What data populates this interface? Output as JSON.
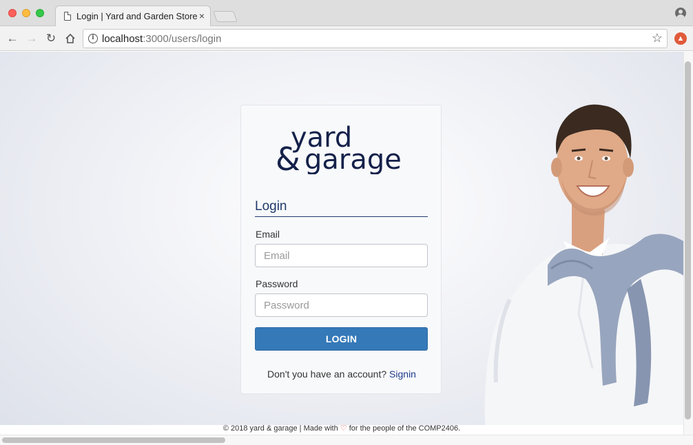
{
  "browser": {
    "tab_title": "Login | Yard and Garden Store",
    "tab_close": "×",
    "url_host": "localhost",
    "url_rest": ":3000/users/login",
    "icons": {
      "back": "arrow-left-icon",
      "forward": "arrow-right-icon",
      "reload": "reload-icon",
      "home": "home-icon",
      "info": "info-icon",
      "star": "star-icon",
      "extension": "extension-icon",
      "profile": "profile-icon"
    }
  },
  "logo": {
    "line1": "yard",
    "amp": "&",
    "line2": "garage",
    "color": "#14214a"
  },
  "login": {
    "heading": "Login",
    "email_label": "Email",
    "email_placeholder": "Email",
    "email_value": "",
    "password_label": "Password",
    "password_placeholder": "Password",
    "password_value": "",
    "button_label": "LOGIN",
    "signup_prompt": "Don't you have an account?",
    "signup_link": "Signin",
    "accent_color": "#3579b8"
  },
  "footer": {
    "text_before": "© 2018 yard & garage | Made with",
    "heart": "♡",
    "text_after": "for the people of the COMP2406."
  }
}
